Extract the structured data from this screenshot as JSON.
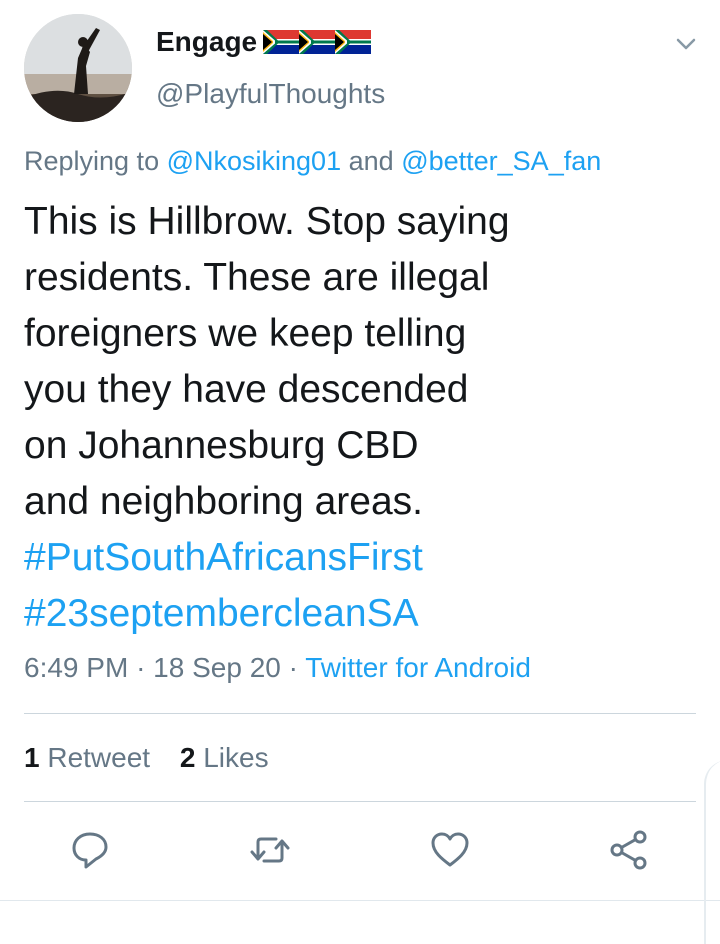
{
  "tweet": {
    "display_name": "Engage",
    "flags": [
      "south-africa-flag",
      "south-africa-flag",
      "south-africa-flag"
    ],
    "handle": "@PlayfulThoughts",
    "replying_prefix": "Replying to",
    "mention_1": "@Nkosiking01",
    "replying_and": "and",
    "mention_2": "@better_SA_fan",
    "text_lines": [
      "This is Hillbrow. Stop saying",
      "residents. These are illegal",
      "foreigners we keep telling",
      "you they have descended",
      "on Johannesburg CBD",
      "and neighboring areas."
    ],
    "hashtags": [
      "#PutSouthAfricansFirst",
      "#23septembercleanSA"
    ],
    "time": "6:49 PM",
    "date": "18 Sep 20",
    "source": "Twitter for Android",
    "separator": "·"
  },
  "stats": {
    "retweet_count": "1",
    "retweet_label": "Retweet",
    "like_count": "2",
    "like_label": "Likes"
  },
  "actions": [
    "reply-icon",
    "retweet-icon",
    "like-icon",
    "share-icon"
  ],
  "colors": {
    "link": "#1da1f2",
    "secondary": "#657786",
    "text": "#14171a",
    "divider": "#ccd6dd"
  }
}
